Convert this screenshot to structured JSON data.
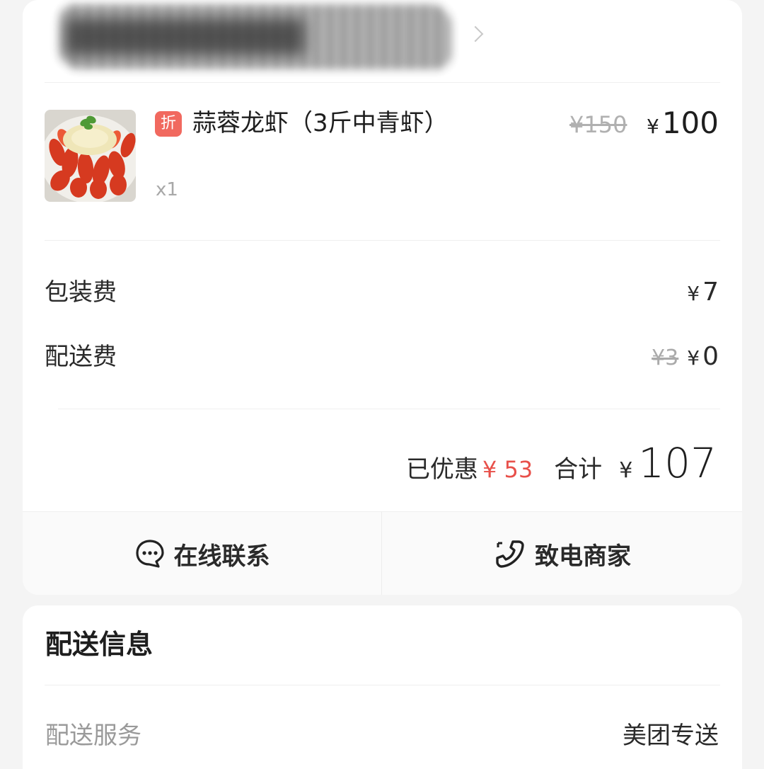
{
  "store": {
    "name": "██████████",
    "chevron_icon": "chevron-right-icon"
  },
  "item": {
    "badge": "折",
    "name": "蒜蓉龙虾（3斤中青虾）",
    "quantity": "x1",
    "original_price": "¥150",
    "price_symbol": "¥",
    "price": "100",
    "image_icon": "crawfish-dish-photo"
  },
  "fees": {
    "packaging_label": "包装费",
    "packaging_symbol": "¥",
    "packaging_value": "7",
    "delivery_label": "配送费",
    "delivery_original": "¥3",
    "delivery_symbol": "¥",
    "delivery_value": "0"
  },
  "totals": {
    "discount_label": "已优惠",
    "discount_value": "¥ 53",
    "sum_label": "合计",
    "sum_symbol": "¥",
    "sum_value": "107",
    "discount_color": "#e8504a"
  },
  "actions": {
    "chat_label": "在线联系",
    "chat_icon": "chat-bubble-icon",
    "call_label": "致电商家",
    "call_icon": "phone-icon"
  },
  "delivery": {
    "title": "配送信息",
    "service_label": "配送服务",
    "service_value": "美团专送"
  }
}
